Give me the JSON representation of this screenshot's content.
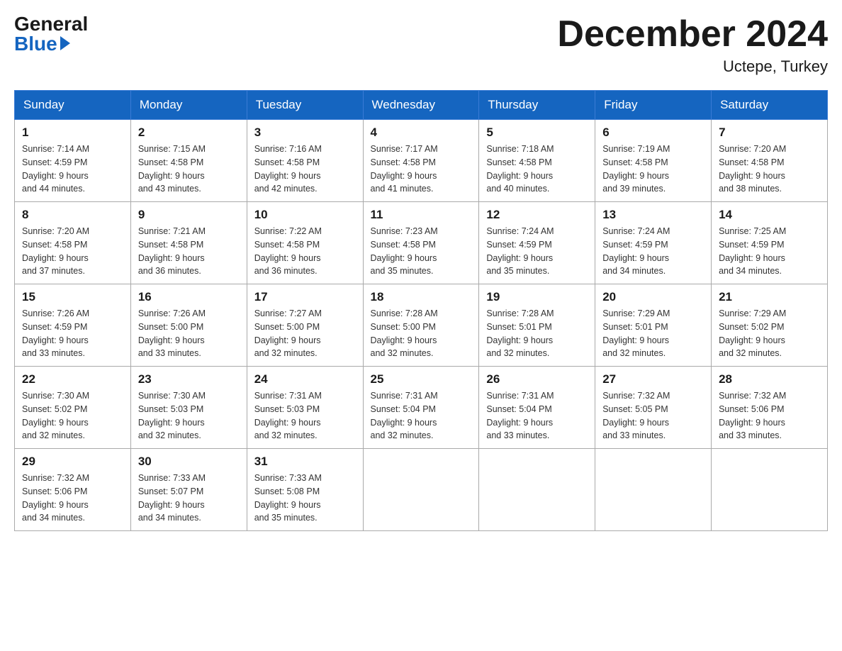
{
  "logo": {
    "general": "General",
    "blue": "Blue"
  },
  "header": {
    "month": "December 2024",
    "location": "Uctepe, Turkey"
  },
  "weekdays": [
    "Sunday",
    "Monday",
    "Tuesday",
    "Wednesday",
    "Thursday",
    "Friday",
    "Saturday"
  ],
  "weeks": [
    [
      {
        "day": "1",
        "sunrise": "7:14 AM",
        "sunset": "4:59 PM",
        "daylight": "9 hours and 44 minutes."
      },
      {
        "day": "2",
        "sunrise": "7:15 AM",
        "sunset": "4:58 PM",
        "daylight": "9 hours and 43 minutes."
      },
      {
        "day": "3",
        "sunrise": "7:16 AM",
        "sunset": "4:58 PM",
        "daylight": "9 hours and 42 minutes."
      },
      {
        "day": "4",
        "sunrise": "7:17 AM",
        "sunset": "4:58 PM",
        "daylight": "9 hours and 41 minutes."
      },
      {
        "day": "5",
        "sunrise": "7:18 AM",
        "sunset": "4:58 PM",
        "daylight": "9 hours and 40 minutes."
      },
      {
        "day": "6",
        "sunrise": "7:19 AM",
        "sunset": "4:58 PM",
        "daylight": "9 hours and 39 minutes."
      },
      {
        "day": "7",
        "sunrise": "7:20 AM",
        "sunset": "4:58 PM",
        "daylight": "9 hours and 38 minutes."
      }
    ],
    [
      {
        "day": "8",
        "sunrise": "7:20 AM",
        "sunset": "4:58 PM",
        "daylight": "9 hours and 37 minutes."
      },
      {
        "day": "9",
        "sunrise": "7:21 AM",
        "sunset": "4:58 PM",
        "daylight": "9 hours and 36 minutes."
      },
      {
        "day": "10",
        "sunrise": "7:22 AM",
        "sunset": "4:58 PM",
        "daylight": "9 hours and 36 minutes."
      },
      {
        "day": "11",
        "sunrise": "7:23 AM",
        "sunset": "4:58 PM",
        "daylight": "9 hours and 35 minutes."
      },
      {
        "day": "12",
        "sunrise": "7:24 AM",
        "sunset": "4:59 PM",
        "daylight": "9 hours and 35 minutes."
      },
      {
        "day": "13",
        "sunrise": "7:24 AM",
        "sunset": "4:59 PM",
        "daylight": "9 hours and 34 minutes."
      },
      {
        "day": "14",
        "sunrise": "7:25 AM",
        "sunset": "4:59 PM",
        "daylight": "9 hours and 34 minutes."
      }
    ],
    [
      {
        "day": "15",
        "sunrise": "7:26 AM",
        "sunset": "4:59 PM",
        "daylight": "9 hours and 33 minutes."
      },
      {
        "day": "16",
        "sunrise": "7:26 AM",
        "sunset": "5:00 PM",
        "daylight": "9 hours and 33 minutes."
      },
      {
        "day": "17",
        "sunrise": "7:27 AM",
        "sunset": "5:00 PM",
        "daylight": "9 hours and 32 minutes."
      },
      {
        "day": "18",
        "sunrise": "7:28 AM",
        "sunset": "5:00 PM",
        "daylight": "9 hours and 32 minutes."
      },
      {
        "day": "19",
        "sunrise": "7:28 AM",
        "sunset": "5:01 PM",
        "daylight": "9 hours and 32 minutes."
      },
      {
        "day": "20",
        "sunrise": "7:29 AM",
        "sunset": "5:01 PM",
        "daylight": "9 hours and 32 minutes."
      },
      {
        "day": "21",
        "sunrise": "7:29 AM",
        "sunset": "5:02 PM",
        "daylight": "9 hours and 32 minutes."
      }
    ],
    [
      {
        "day": "22",
        "sunrise": "7:30 AM",
        "sunset": "5:02 PM",
        "daylight": "9 hours and 32 minutes."
      },
      {
        "day": "23",
        "sunrise": "7:30 AM",
        "sunset": "5:03 PM",
        "daylight": "9 hours and 32 minutes."
      },
      {
        "day": "24",
        "sunrise": "7:31 AM",
        "sunset": "5:03 PM",
        "daylight": "9 hours and 32 minutes."
      },
      {
        "day": "25",
        "sunrise": "7:31 AM",
        "sunset": "5:04 PM",
        "daylight": "9 hours and 32 minutes."
      },
      {
        "day": "26",
        "sunrise": "7:31 AM",
        "sunset": "5:04 PM",
        "daylight": "9 hours and 33 minutes."
      },
      {
        "day": "27",
        "sunrise": "7:32 AM",
        "sunset": "5:05 PM",
        "daylight": "9 hours and 33 minutes."
      },
      {
        "day": "28",
        "sunrise": "7:32 AM",
        "sunset": "5:06 PM",
        "daylight": "9 hours and 33 minutes."
      }
    ],
    [
      {
        "day": "29",
        "sunrise": "7:32 AM",
        "sunset": "5:06 PM",
        "daylight": "9 hours and 34 minutes."
      },
      {
        "day": "30",
        "sunrise": "7:33 AM",
        "sunset": "5:07 PM",
        "daylight": "9 hours and 34 minutes."
      },
      {
        "day": "31",
        "sunrise": "7:33 AM",
        "sunset": "5:08 PM",
        "daylight": "9 hours and 35 minutes."
      },
      null,
      null,
      null,
      null
    ]
  ],
  "labels": {
    "sunrise": "Sunrise:",
    "sunset": "Sunset:",
    "daylight": "Daylight:"
  }
}
